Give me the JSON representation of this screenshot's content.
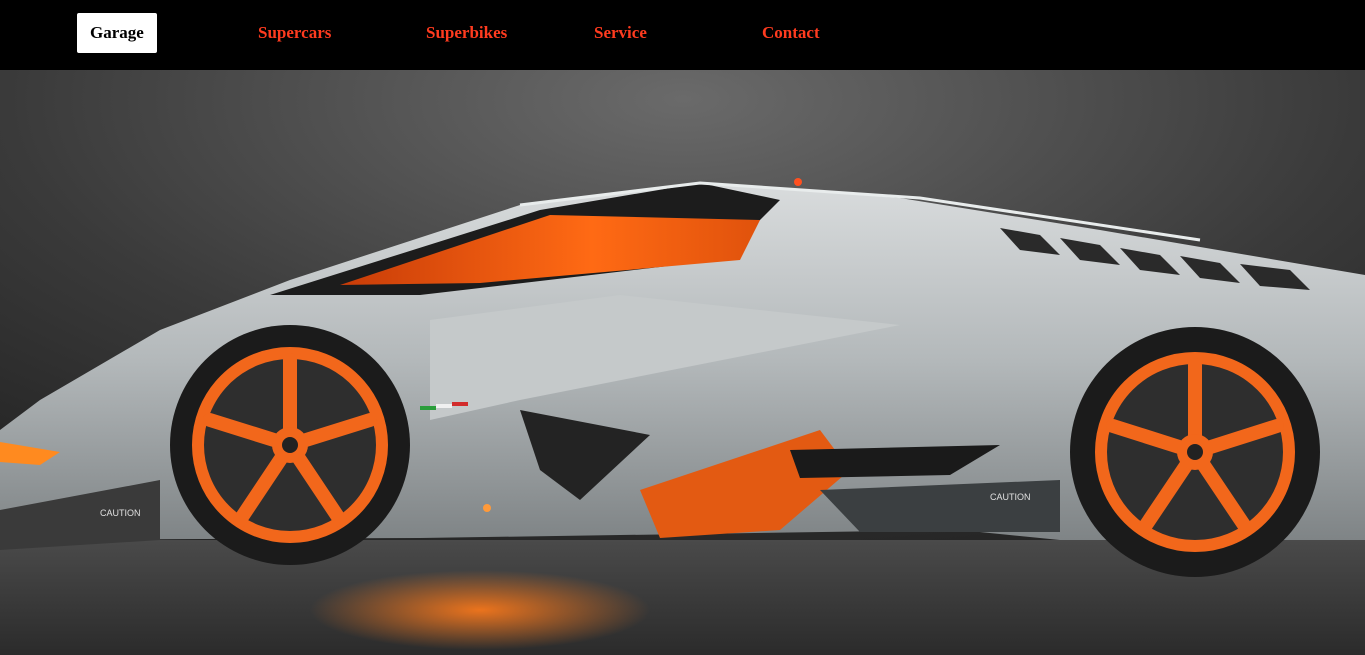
{
  "nav": {
    "items": [
      {
        "label": "Garage",
        "active": true
      },
      {
        "label": "Supercars"
      },
      {
        "label": "Superbikes"
      },
      {
        "label": "Service"
      },
      {
        "label": "Contact"
      }
    ]
  },
  "hero": {
    "subject": "silver-supercar-with-orange-wheels",
    "caution_label_front": "CAUTION",
    "caution_label_rear": "CAUTION"
  },
  "colors": {
    "nav_background": "#000000",
    "accent": "#ff3b1f",
    "active_tab_background": "#ffffff",
    "wheel_orange": "#f2671b",
    "car_silver": "#b7bcbd"
  }
}
